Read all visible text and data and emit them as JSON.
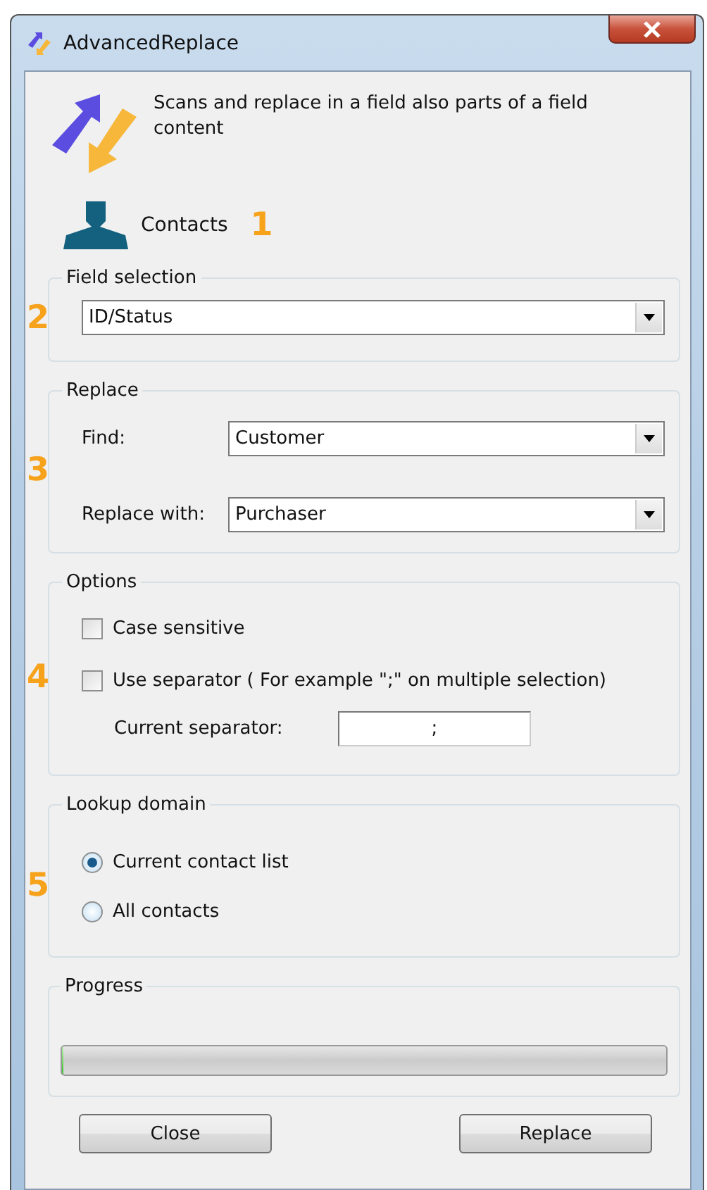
{
  "window": {
    "title": "AdvancedReplace"
  },
  "header": {
    "description": "Scans and replace in a field also parts of a field content"
  },
  "entity": {
    "label": "Contacts",
    "marker": "1"
  },
  "field_selection": {
    "legend": "Field selection",
    "marker": "2",
    "value": "ID/Status"
  },
  "replace": {
    "legend": "Replace",
    "marker": "3",
    "rows": [
      {
        "label": "Find:",
        "value": "Customer"
      },
      {
        "label": "Replace with:",
        "value": "Purchaser"
      }
    ]
  },
  "options": {
    "legend": "Options",
    "marker": "4",
    "checkboxes": [
      {
        "label": "Case sensitive",
        "checked": false
      },
      {
        "label": "Use separator ( For example \";\" on multiple selection)",
        "checked": false
      }
    ],
    "separator": {
      "label": "Current separator:",
      "value": ";"
    }
  },
  "lookup_domain": {
    "legend": "Lookup domain",
    "marker": "5",
    "radios": [
      {
        "label": "Current contact list",
        "selected": true
      },
      {
        "label": "All contacts",
        "selected": false
      }
    ]
  },
  "progress": {
    "legend": "Progress",
    "level": 0
  },
  "buttons": [
    {
      "label": "Close"
    },
    {
      "label": "Replace"
    }
  ]
}
